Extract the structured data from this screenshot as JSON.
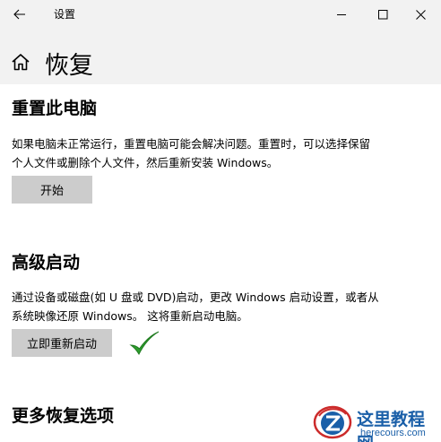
{
  "window": {
    "title": "设置",
    "back_icon": "back-arrow-icon",
    "min_icon": "minimize-icon",
    "max_icon": "maximize-icon",
    "close_icon": "close-icon"
  },
  "header": {
    "home_icon": "home-icon",
    "title": "恢复"
  },
  "reset": {
    "title": "重置此电脑",
    "line1": "如果电脑未正常运行，重置电脑可能会解决问题。重置时，可以选择保留",
    "line2": "个人文件或删除个人文件，然后重新安装 Windows。",
    "button_label": "开始"
  },
  "advanced": {
    "title": "高级启动",
    "line1": "通过设备或磁盘(如 U 盘或 DVD)启动，更改 Windows 启动设置，或者从",
    "line2": "系统映像还原 Windows。 这将重新启动电脑。",
    "button_label": "立即重新启动",
    "check_icon": "green-check-icon",
    "check_color": "#2e9e2e"
  },
  "more": {
    "title": "更多恢复选项"
  },
  "watermark": {
    "title": "这里教程网",
    "domain": "herecours.com",
    "color": "#1a5fa8"
  }
}
